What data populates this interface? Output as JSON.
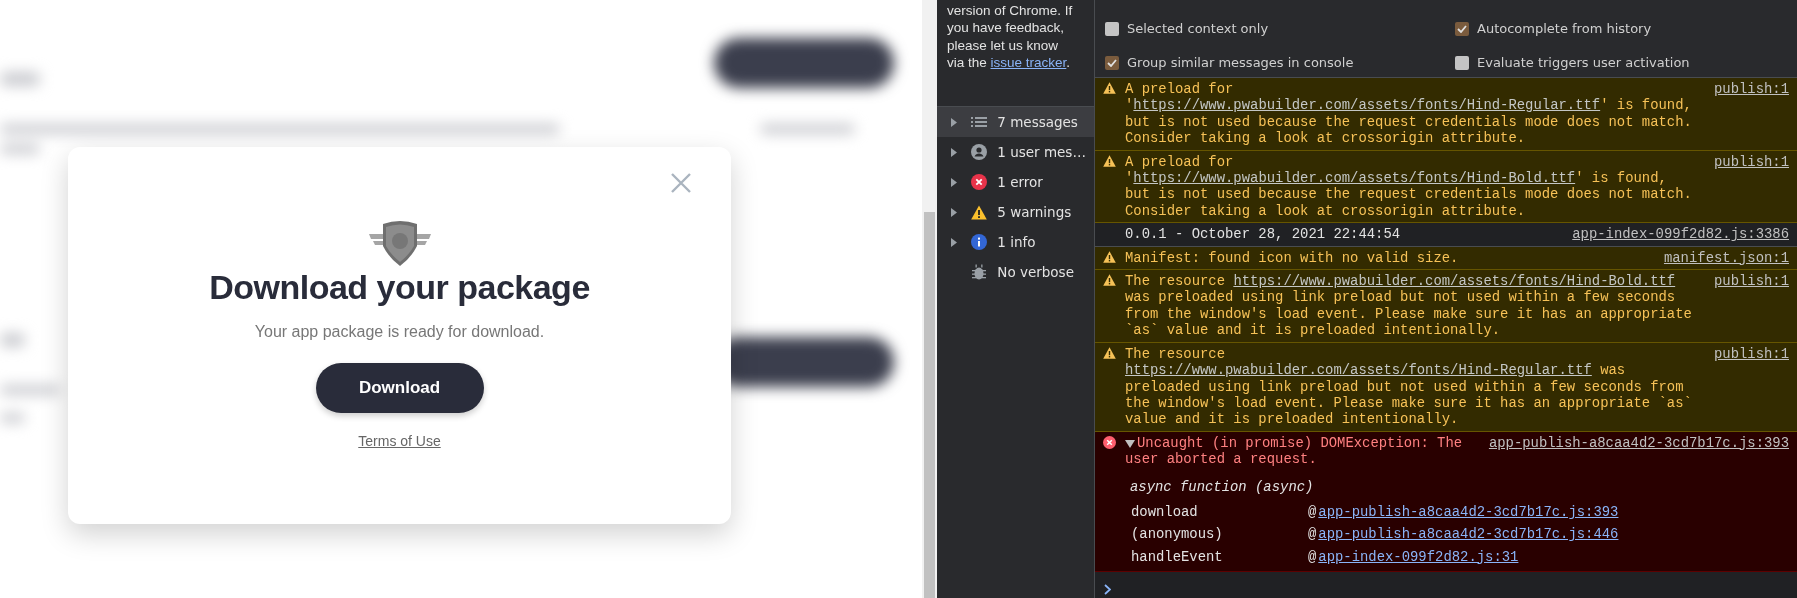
{
  "dialog": {
    "title": "Download your package",
    "message": "Your app package is ready for download.",
    "button": "Download",
    "link": "Terms of Use"
  },
  "devtools": {
    "note": {
      "text": "version of Chrome. If you have feedback, please let us know via the",
      "link": "issue tracker",
      "end": "."
    },
    "filters": [
      {
        "kind": "list",
        "label": "7 messages",
        "expandable": true,
        "selected": true
      },
      {
        "kind": "user",
        "label": "1 user mes…",
        "expandable": true,
        "selected": false
      },
      {
        "kind": "error",
        "label": "1 error",
        "expandable": true,
        "selected": false
      },
      {
        "kind": "warning",
        "label": "5 warnings",
        "expandable": true,
        "selected": false
      },
      {
        "kind": "info",
        "label": "1 info",
        "expandable": true,
        "selected": false
      },
      {
        "kind": "verbose",
        "label": "No verbose",
        "expandable": false,
        "selected": false
      }
    ],
    "settings": [
      {
        "label": "Selected context only",
        "checked": false
      },
      {
        "label": "Autocomplete from history",
        "checked": true
      },
      {
        "label": "Group similar messages in console",
        "checked": true
      },
      {
        "label": "Evaluate triggers user activation",
        "checked": false
      }
    ],
    "messages": [
      {
        "kind": "warning",
        "before": "A preload for '",
        "link": "https://www.pwabuilder.com/assets/fonts/Hind-Regular.ttf",
        "after": "' is found, but is not used because the request credentials mode does not match. Consider taking a look at crossorigin attribute.",
        "source": "publish:1"
      },
      {
        "kind": "warning",
        "before": "A preload for '",
        "link": "https://www.pwabuilder.com/assets/fonts/Hind-Bold.ttf",
        "after": "' is found, but is not used because the request credentials mode does not match. Consider taking a look at crossorigin attribute.",
        "source": "publish:1"
      },
      {
        "kind": "log",
        "before": "0.0.1 - October 28, 2021 22:44:54",
        "source": "app-index-099f2d82.js:3386"
      },
      {
        "kind": "warning",
        "before": "Manifest: found icon with no valid size.",
        "source": "manifest.json:1"
      },
      {
        "kind": "warning",
        "before": "The resource ",
        "link": "https://www.pwabuilder.com/assets/fonts/Hind-Bold.ttf",
        "after": " was preloaded using link preload but not used within a few seconds from the window's load event. Please make sure it has an appropriate `as` value and it is preloaded intentionally.",
        "source": "publish:1"
      },
      {
        "kind": "warning",
        "before": "The resource ",
        "link": "https://www.pwabuilder.com/assets/fonts/Hind-Regular.ttf",
        "after": " was preloaded using link preload but not used within a few seconds from the window's load event. Please make sure it has an appropriate `as` value and it is preloaded intentionally.",
        "source": "publish:1"
      },
      {
        "kind": "error",
        "expanded": true,
        "before": "Uncaught (in promise) DOMException: The user aborted a request.",
        "source": "app-publish-a8caa4d2-3cd7b17c.js:393",
        "stack_title": "async function (async)",
        "stack": [
          {
            "function": "download",
            "at": "@",
            "link": "app-publish-a8caa4d2-3cd7b17c.js:393"
          },
          {
            "function": "(anonymous)",
            "at": "@",
            "link": "app-publish-a8caa4d2-3cd7b17c.js:446"
          },
          {
            "function": "handleEvent",
            "at": "@",
            "link": "app-index-099f2d82.js:31"
          }
        ]
      }
    ]
  }
}
